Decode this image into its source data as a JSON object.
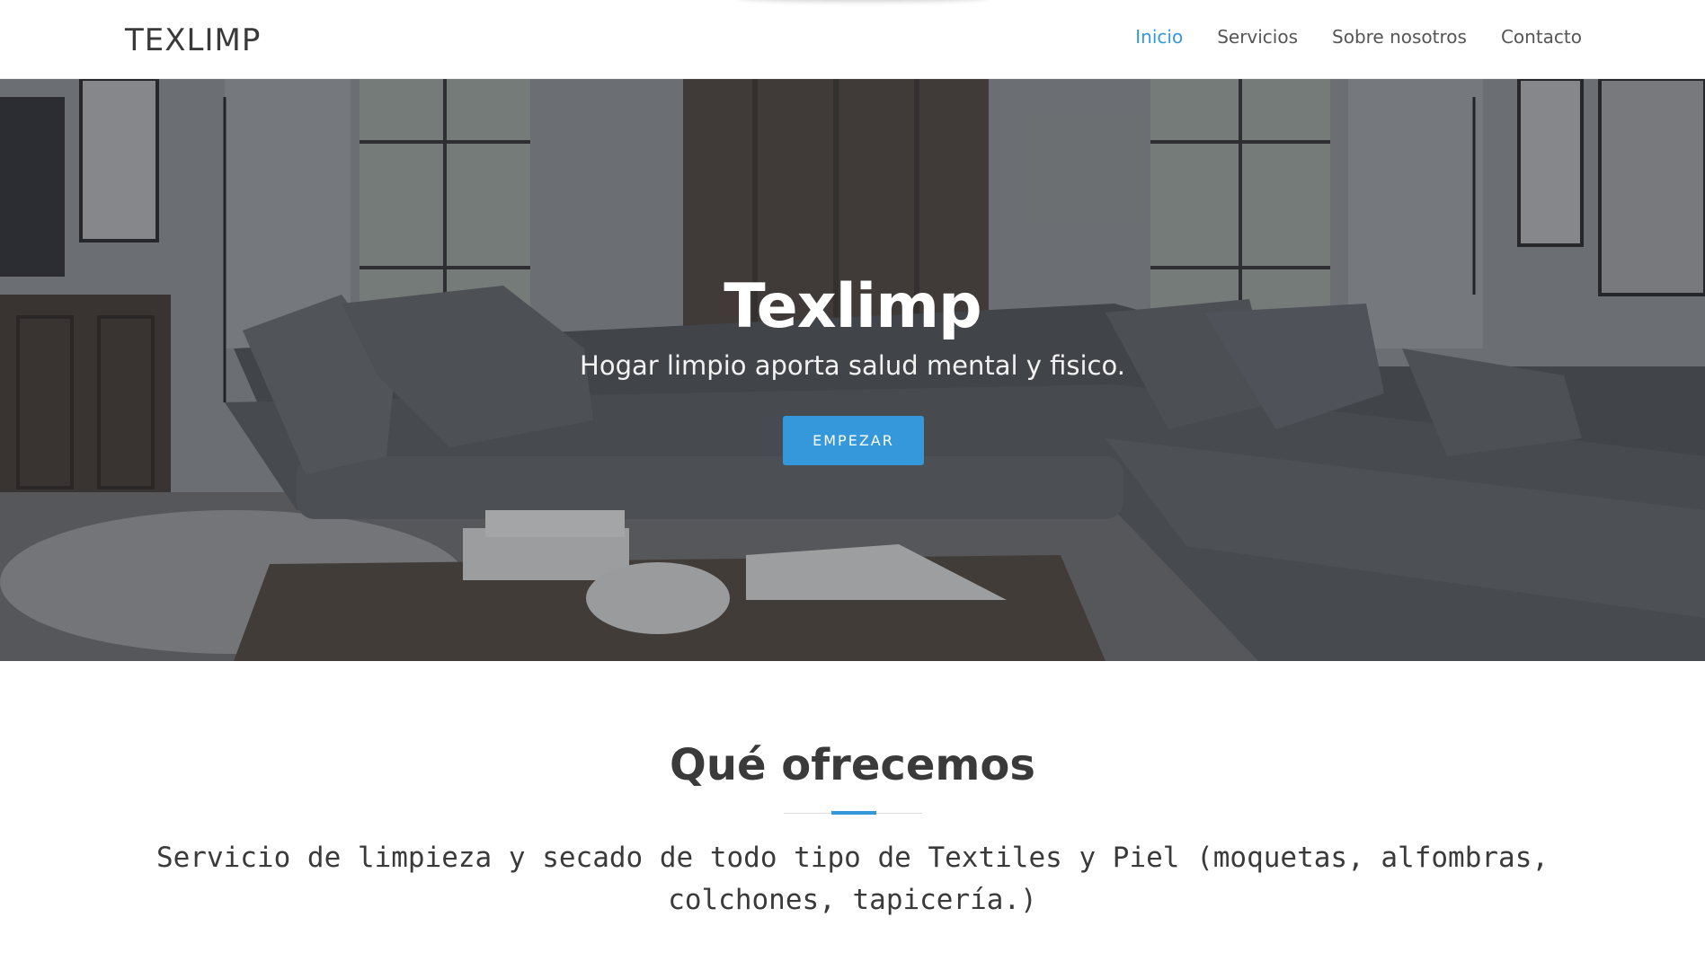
{
  "brand": {
    "logo": "TEXLIMP"
  },
  "nav": {
    "items": [
      {
        "label": "Inicio",
        "active": true
      },
      {
        "label": "Servicios",
        "active": false
      },
      {
        "label": "Sobre nosotros",
        "active": false
      },
      {
        "label": "Contacto",
        "active": false
      }
    ]
  },
  "hero": {
    "title": "Texlimp",
    "subtitle": "Hogar limpio aporta salud mental y fisico.",
    "button_label": "EMPEZAR"
  },
  "offer": {
    "title": "Qué ofrecemos",
    "text": "Servicio de limpieza y secado de todo tipo de Textiles y Piel (moquetas, alfombras, colchones, tapicería.)"
  },
  "colors": {
    "accent": "#3498db",
    "text_dark": "#3a3a3a",
    "nav_text": "#555555"
  }
}
